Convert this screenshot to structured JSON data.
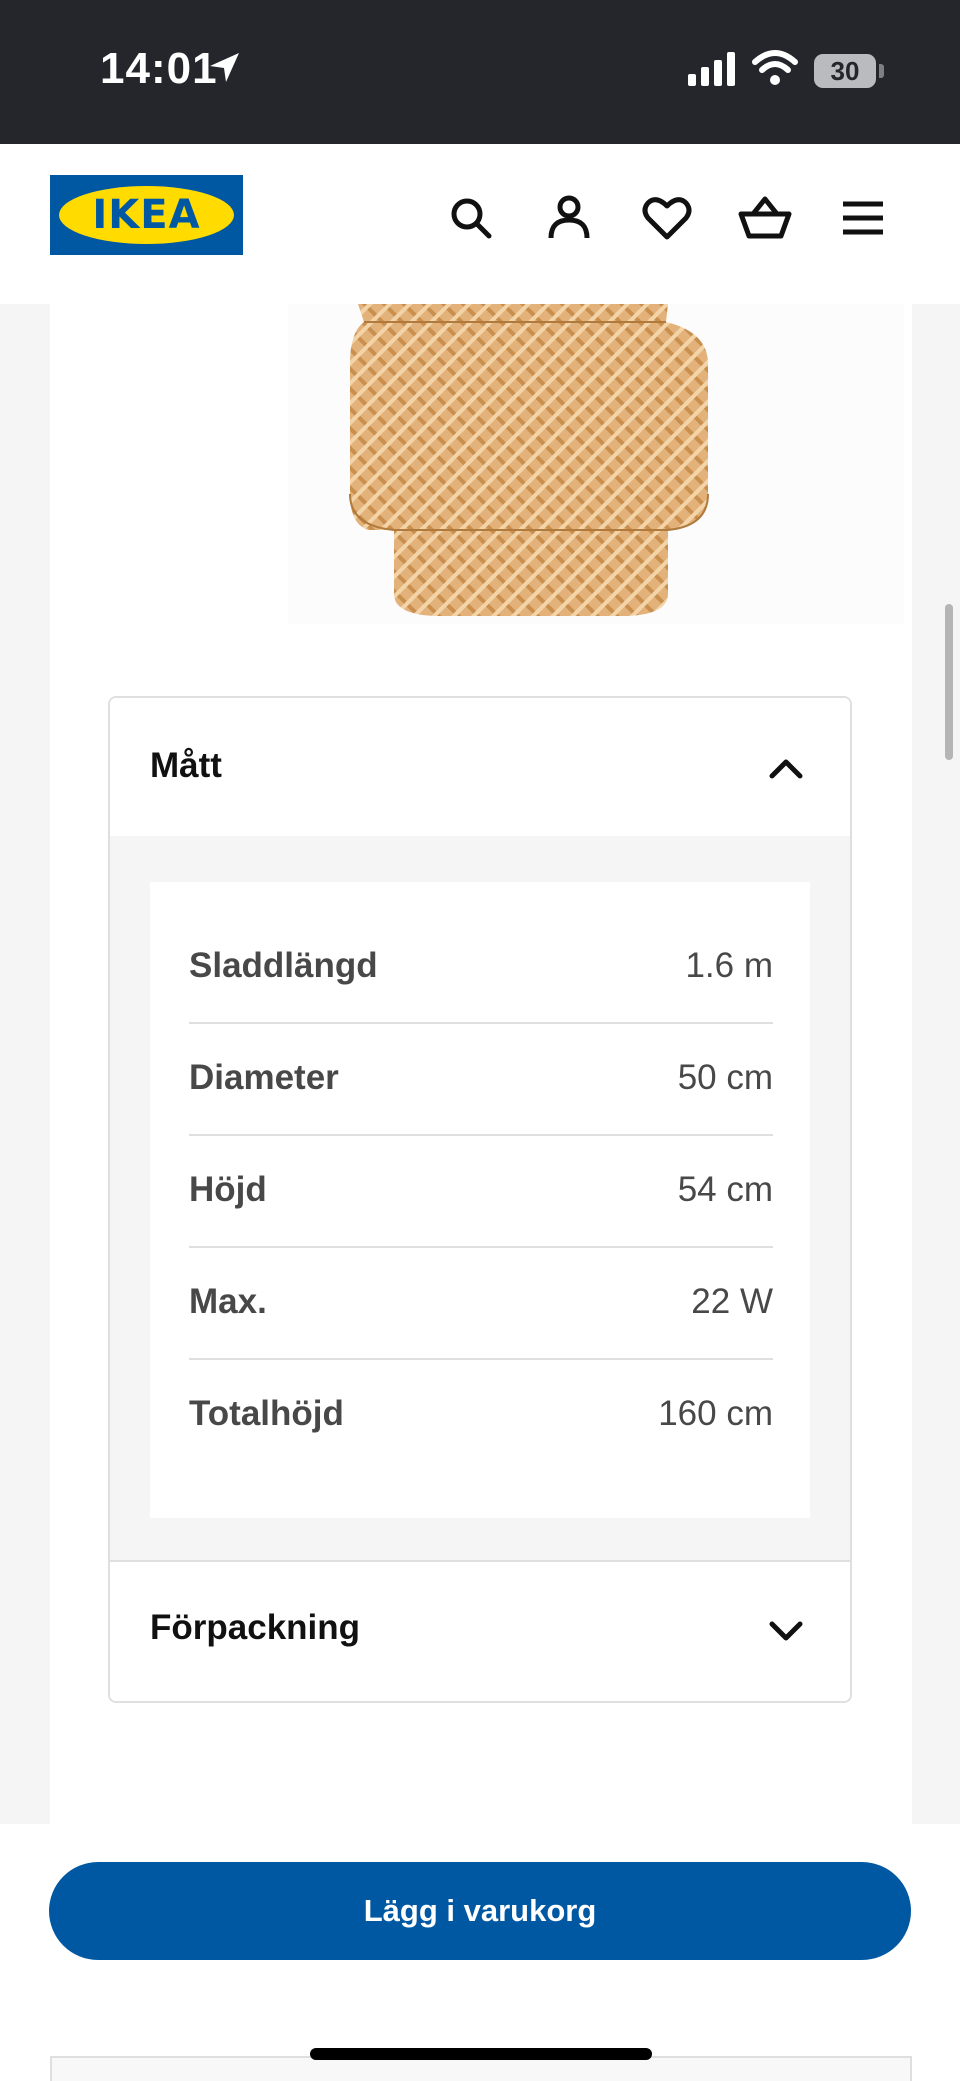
{
  "status_bar": {
    "time": "14:01",
    "battery": "30"
  },
  "header": {
    "logo_text": "IKEA",
    "icons": [
      "search-icon",
      "account-icon",
      "heart-icon",
      "basket-icon",
      "menu-icon"
    ]
  },
  "product_image": {
    "description_icon": "pendant-lamp-image"
  },
  "dimensions": {
    "title": "Mått",
    "expanded": true,
    "rows": [
      {
        "label": "Sladdlängd",
        "value": "1.6 m"
      },
      {
        "label": "Diameter",
        "value": "50 cm"
      },
      {
        "label": "Höjd",
        "value": "54 cm"
      },
      {
        "label": "Max.",
        "value": "22 W"
      },
      {
        "label": "Totalhöjd",
        "value": "160 cm"
      }
    ]
  },
  "packaging": {
    "title": "Förpackning",
    "expanded": false
  },
  "cta": {
    "label": "Lägg i varukorg"
  },
  "colors": {
    "ikea_blue": "#0058a3",
    "ikea_yellow": "#ffdb00",
    "status_bar_bg": "#24262b"
  }
}
